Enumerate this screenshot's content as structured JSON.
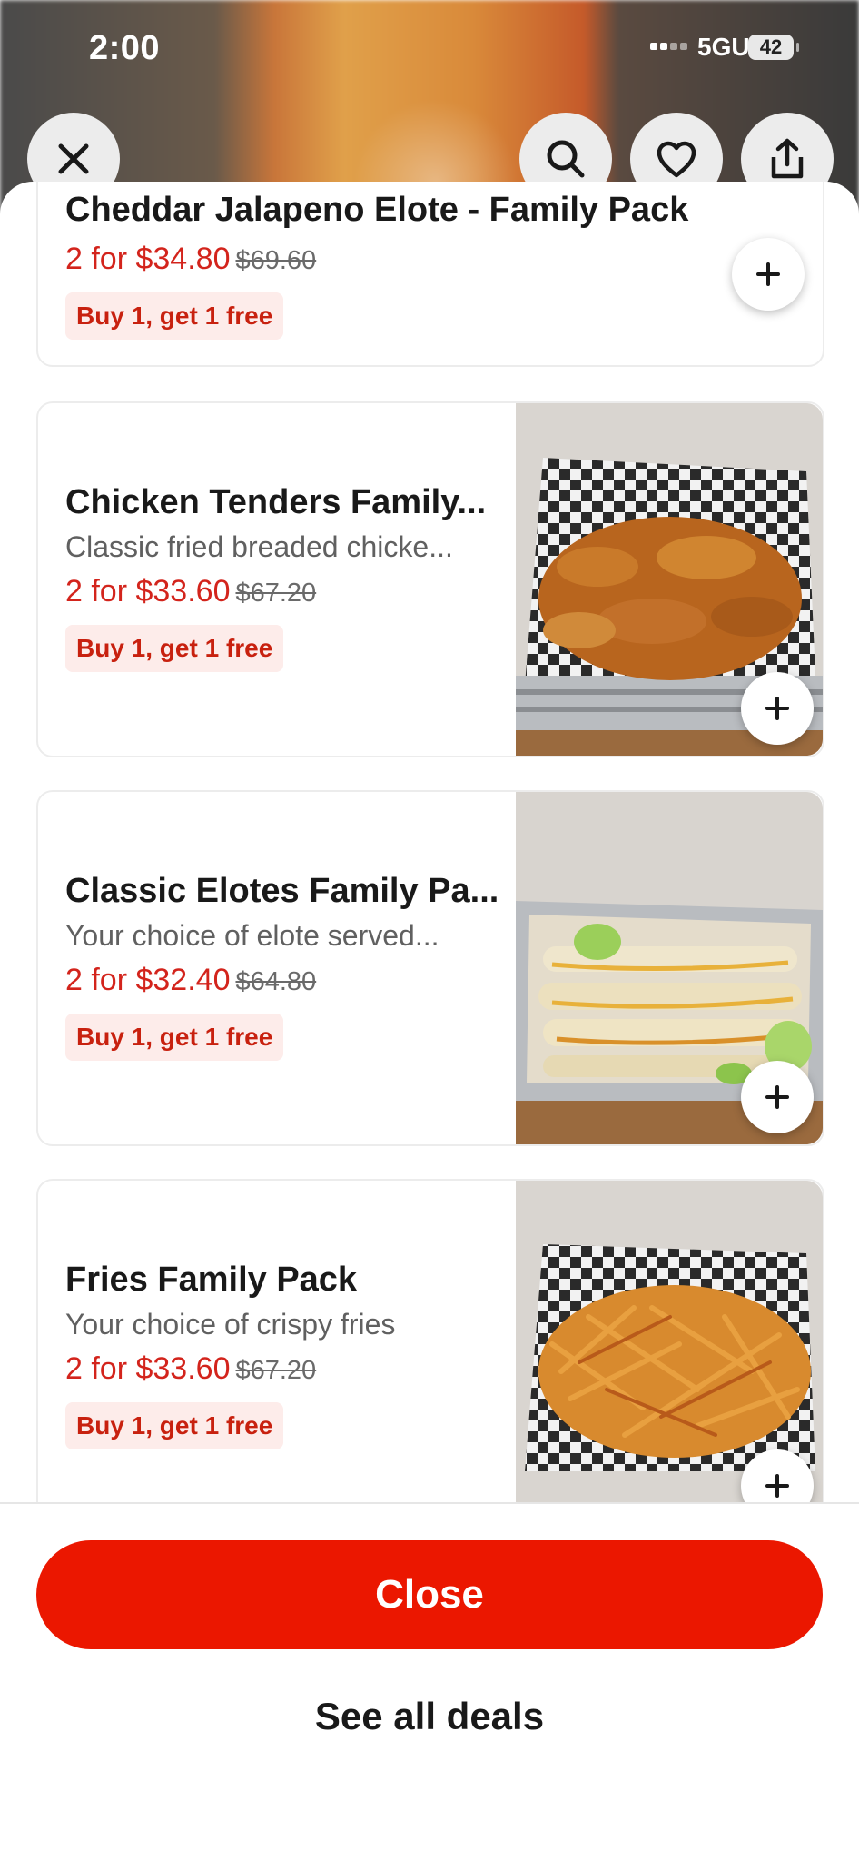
{
  "status_bar": {
    "time": "2:00",
    "network": "5GUC",
    "battery": "42"
  },
  "top_buttons": [
    "close-icon",
    "search-icon",
    "heart-icon",
    "share-icon"
  ],
  "items": [
    {
      "title": "Cheddar Jalapeno Elote - Family Pack",
      "price": "2 for $34.80",
      "original_price": "$69.60",
      "badge": "Buy 1, get 1 free"
    },
    {
      "title": "Chicken Tenders Family...",
      "desc": "Classic fried breaded chicke...",
      "price": "2 for $33.60",
      "original_price": "$67.20",
      "badge": "Buy 1, get 1 free"
    },
    {
      "title": "Classic Elotes Family Pa...",
      "desc": "Your choice of elote served...",
      "price": "2 for $32.40",
      "original_price": "$64.80",
      "badge": "Buy 1, get 1 free"
    },
    {
      "title": "Fries Family Pack",
      "desc": "Your choice of crispy fries",
      "price": "2 for $33.60",
      "original_price": "$67.20",
      "badge": "Buy 1, get 1 free"
    }
  ],
  "footer": {
    "close_label": "Close",
    "see_all_label": "See all deals"
  },
  "colors": {
    "accent": "#eb1700",
    "price": "#d3241c",
    "badge_bg": "#fdecea"
  }
}
